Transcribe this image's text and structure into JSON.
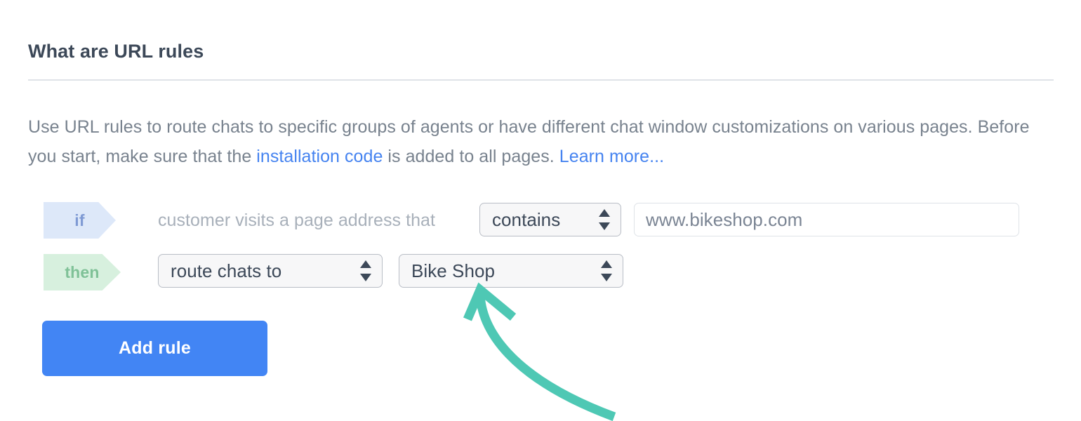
{
  "header": {
    "title": "What are URL rules"
  },
  "description": {
    "part1": "Use URL rules to route chats to specific groups of agents or have different chat window customizations on various pages. Before you start, make sure that the ",
    "link1": "installation code",
    "part2": " is added to all pages. ",
    "link2": "Learn more..."
  },
  "rule": {
    "if_tag": "if",
    "then_tag": "then",
    "condition_text": "customer visits a page address that",
    "operator_value": "contains",
    "url_value": "www.bikeshop.com",
    "url_placeholder": "www.bikeshop.com",
    "action_value": "route chats to",
    "group_value": "Bike Shop"
  },
  "buttons": {
    "add_rule": "Add rule"
  },
  "colors": {
    "accent_blue": "#4285f4",
    "link_blue": "#4583f0",
    "if_badge_bg": "#dde8f9",
    "if_badge_text": "#7f9ad4",
    "then_badge_bg": "#d7f0de",
    "then_badge_text": "#7fc197",
    "annotation_teal": "#4ec8b4",
    "heading_text": "#3c4858",
    "body_text": "#78828e"
  },
  "annotation": {
    "arrow": "curved-up-arrow-pointing-to-group-select"
  }
}
